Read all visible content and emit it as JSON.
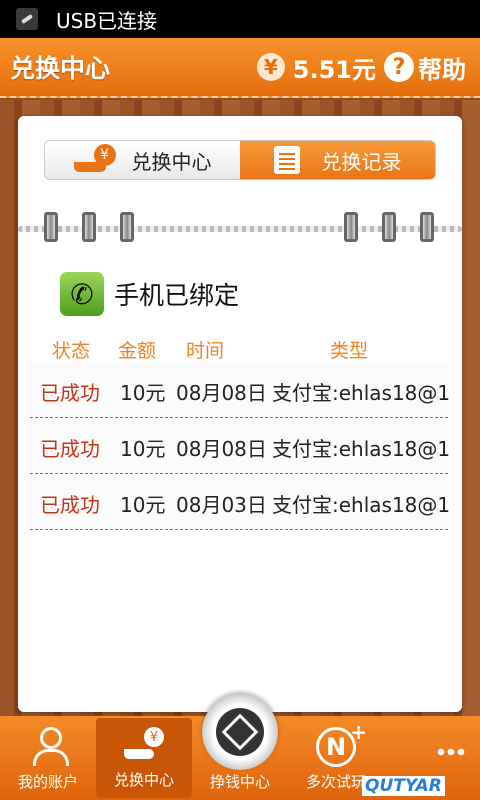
{
  "statusbar": {
    "text": "USB已连接",
    "icon": "usb-icon"
  },
  "header": {
    "title": "兑换中心",
    "balance_symbol": "¥",
    "balance": "5.51元",
    "help_symbol": "?",
    "help_label": "帮助"
  },
  "tabs": [
    {
      "label": "兑换中心",
      "icon": "hand-coin-icon",
      "active": false
    },
    {
      "label": "兑换记录",
      "icon": "list-icon",
      "active": true
    }
  ],
  "binding": {
    "icon": "phone-icon",
    "text": "手机已绑定"
  },
  "table": {
    "headers": [
      "状态",
      "金额",
      "时间",
      "类型"
    ],
    "rows": [
      {
        "status": "已成功",
        "amount": "10元",
        "time": "08月08日",
        "type": "支付宝:ehlas18@1"
      },
      {
        "status": "已成功",
        "amount": "10元",
        "time": "08月08日",
        "type": "支付宝:ehlas18@1"
      },
      {
        "status": "已成功",
        "amount": "10元",
        "time": "08月03日",
        "type": "支付宝:ehlas18@1"
      }
    ]
  },
  "nav": [
    {
      "label": "我的账户",
      "icon": "person-icon",
      "active": false
    },
    {
      "label": "兑换中心",
      "icon": "hand-coin-icon",
      "active": true
    },
    {
      "label": "挣钱中心",
      "icon": "earn-icon",
      "active": false
    },
    {
      "label": "多次试玩",
      "icon": "n-plus-icon",
      "active": false
    }
  ],
  "watermark": "QUTYAR",
  "colors": {
    "accent": "#ea7415",
    "status_success": "#c8341a",
    "header_text": "#f08423"
  }
}
